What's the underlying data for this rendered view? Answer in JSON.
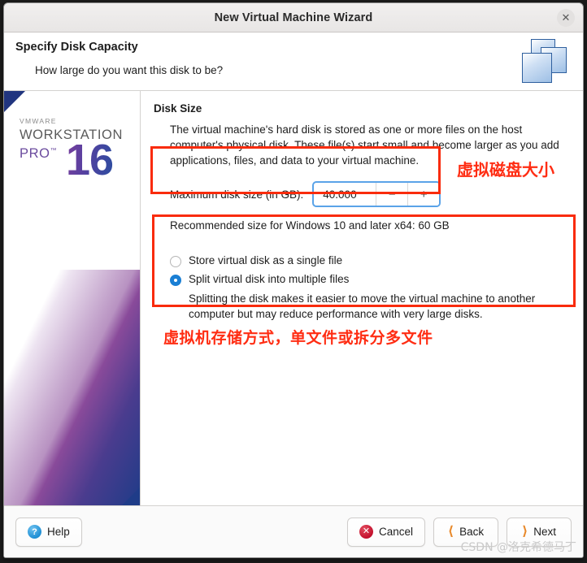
{
  "window": {
    "title": "New Virtual Machine Wizard",
    "close_icon": "close-icon"
  },
  "header": {
    "title": "Specify Disk Capacity",
    "subtitle": "How large do you want this disk to be?",
    "icon": "stacked-squares-icon"
  },
  "sidebar": {
    "brand_vmware": "VMWARE",
    "brand_workstation": "WORKSTATION",
    "brand_pro": "PRO",
    "brand_pro_tm": "™",
    "brand_version": "16"
  },
  "main": {
    "section_title": "Disk Size",
    "description": "The virtual machine's hard disk is stored as one or more files on the host computer's physical disk. These file(s) start small and become larger as you add applications, files, and data to your virtual machine.",
    "spinner": {
      "label": "Maximum disk size (in GB):",
      "value": "40.000",
      "decrement_label": "−",
      "increment_label": "+"
    },
    "recommended_note": "Recommended size for Windows 10 and later x64: 60 GB",
    "storage_options": [
      {
        "label": "Store virtual disk as a single file",
        "selected": false
      },
      {
        "label": "Split virtual disk into multiple files",
        "selected": true,
        "help": "Splitting the disk makes it easier to move the virtual machine to another computer but may reduce performance with very large disks."
      }
    ]
  },
  "annotations": {
    "disk_size": "虚拟磁盘大小",
    "storage_mode": "虚拟机存储方式，单文件或拆分多文件",
    "accent_color": "#ff2d13"
  },
  "footer": {
    "help_label": "Help",
    "help_icon": "question-mark-icon",
    "cancel_label": "Cancel",
    "cancel_icon": "error-circle-icon",
    "back_label": "Back",
    "back_icon": "chevron-left-icon",
    "next_label": "Next",
    "next_icon": "chevron-right-icon"
  },
  "watermark": {
    "text": "CSDN @洛克希德马丁"
  }
}
